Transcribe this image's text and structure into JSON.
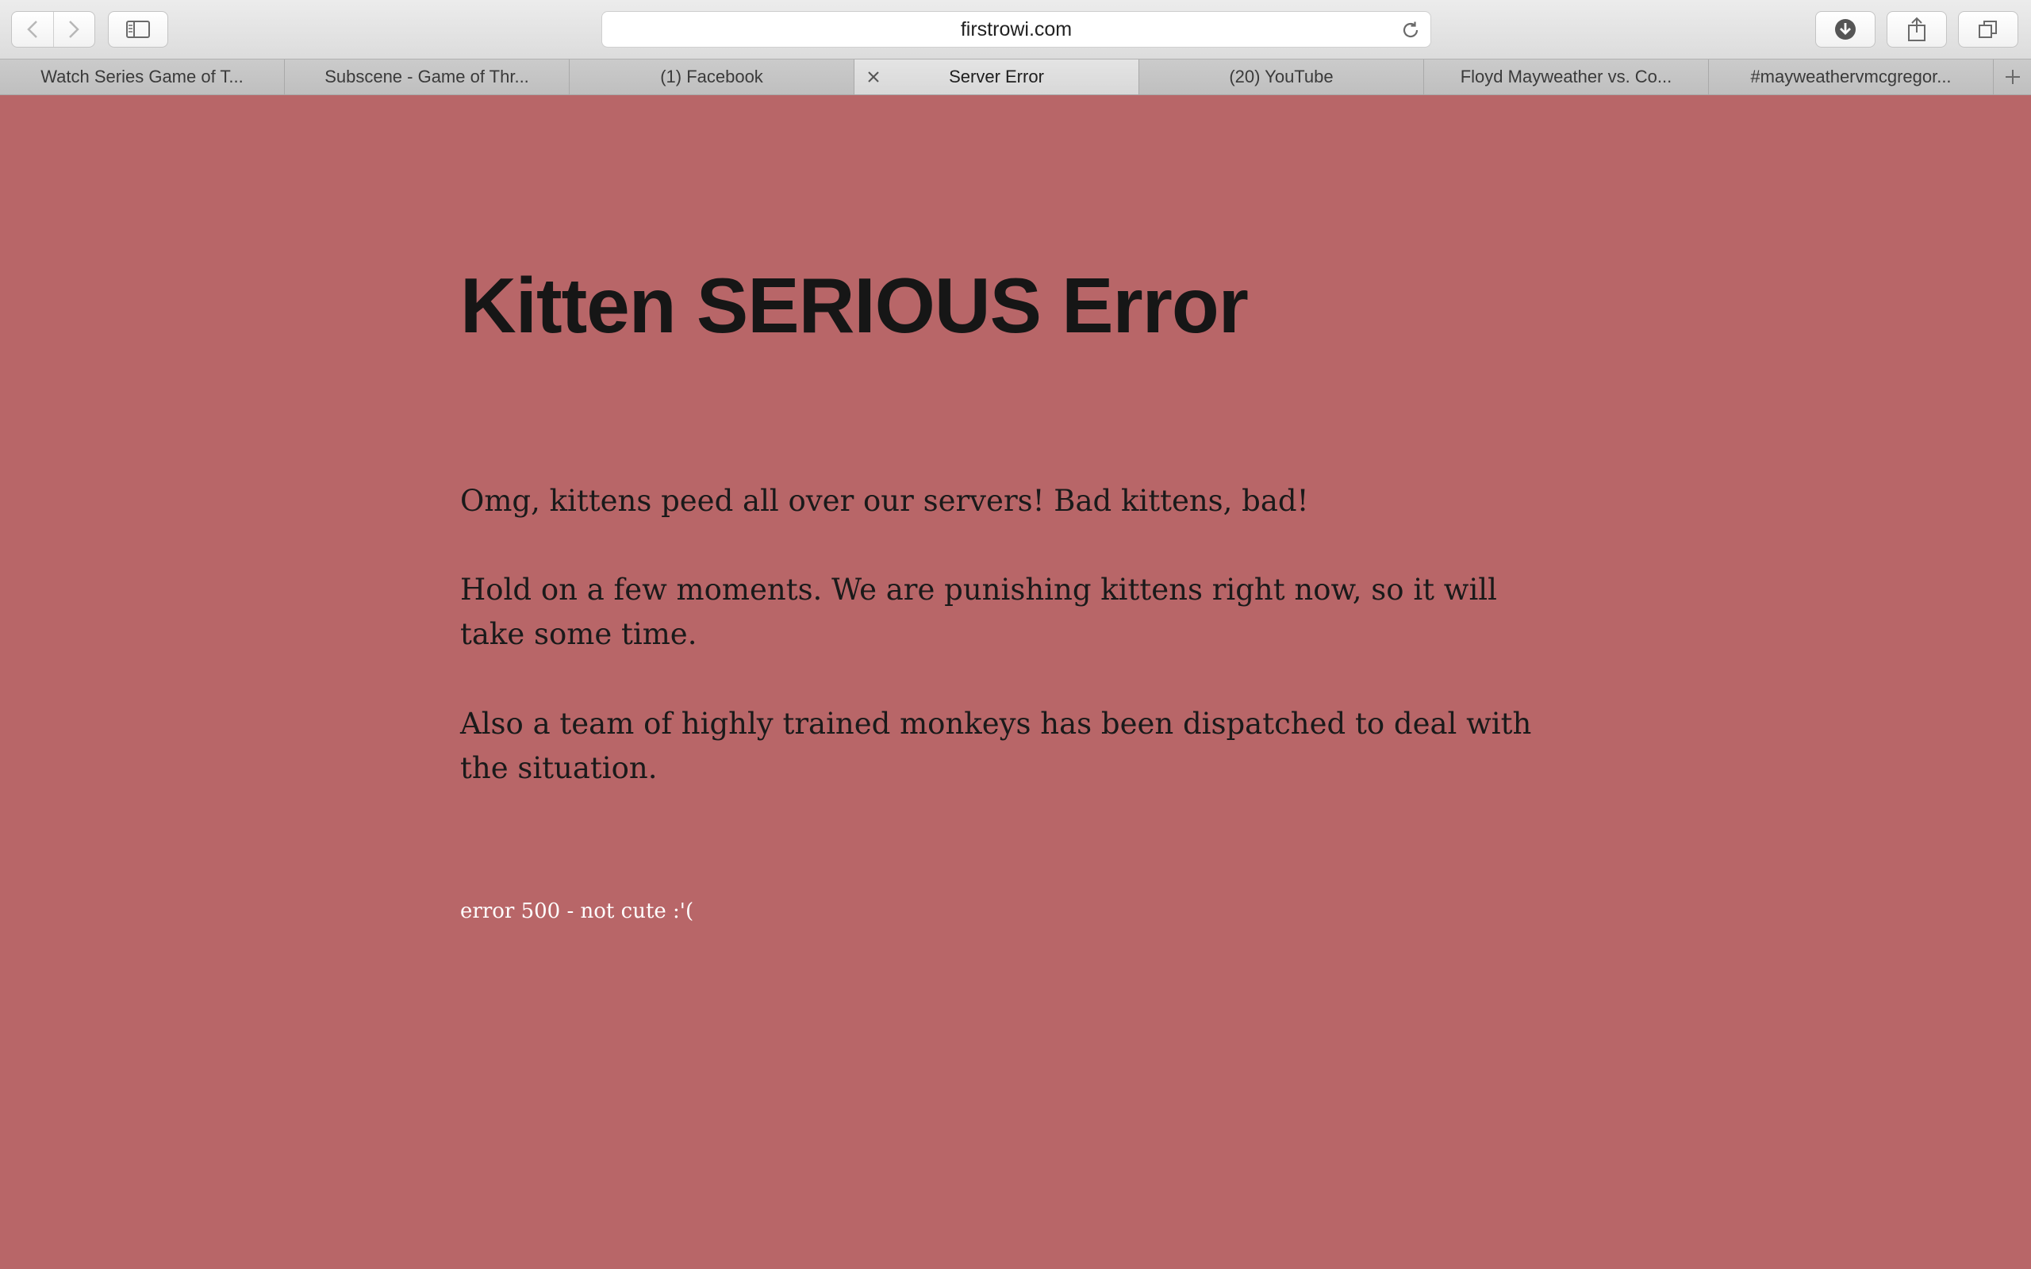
{
  "browser": {
    "address": "firstrowi.com",
    "tabs": [
      {
        "label": "Watch Series Game of T...",
        "active": false
      },
      {
        "label": "Subscene - Game of Thr...",
        "active": false
      },
      {
        "label": "(1) Facebook",
        "active": false
      },
      {
        "label": "Server Error",
        "active": true
      },
      {
        "label": "(20) YouTube",
        "active": false
      },
      {
        "label": "Floyd Mayweather vs. Co...",
        "active": false
      },
      {
        "label": "#mayweathervmcgregor...",
        "active": false
      }
    ],
    "icons": {
      "back": "chevron-left-icon",
      "forward": "chevron-right-icon",
      "sidebar": "sidebar-icon",
      "reload": "reload-icon",
      "downloads": "download-icon",
      "share": "share-icon",
      "tabs_overview": "tabs-overview-icon",
      "new_tab": "plus-icon",
      "close_tab": "close-icon"
    }
  },
  "page": {
    "background_color": "#b86668",
    "title": "Kitten SERIOUS Error",
    "paragraphs": [
      "Omg, kittens peed all over our servers! Bad kittens, bad!",
      "Hold on a few moments. We are punishing kittens right now, so it will take some time.",
      "Also a team of highly trained monkeys has been dispatched to deal with the situation."
    ],
    "footer_note": "error 500 - not cute :'("
  }
}
